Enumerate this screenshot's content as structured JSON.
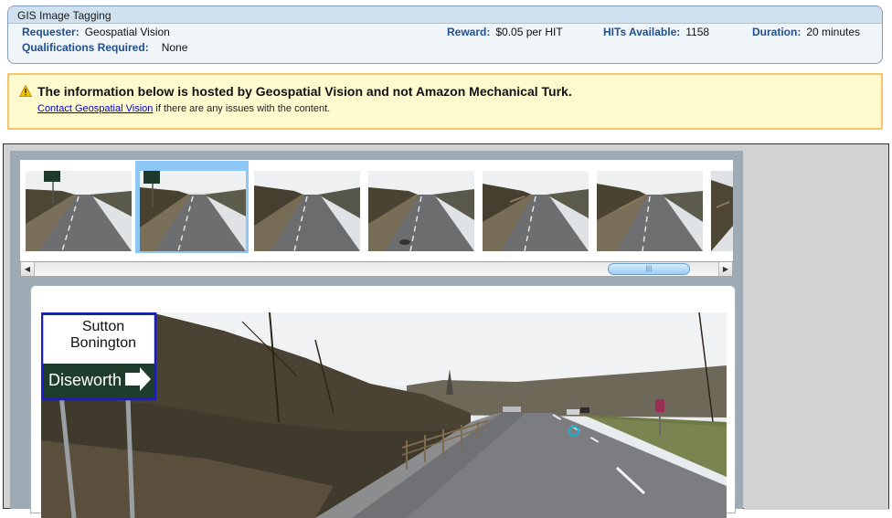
{
  "hit": {
    "title": "GIS Image Tagging",
    "requester_label": "Requester:",
    "requester": "Geospatial Vision",
    "qualifications_label": "Qualifications Required:",
    "qualifications": "None",
    "reward_label": "Reward:",
    "reward": "$0.05 per HIT",
    "hits_label": "HITs Available:",
    "hits": "1158",
    "duration_label": "Duration:",
    "duration": "20 minutes"
  },
  "notice": {
    "title": "The information below is hosted by Geospatial Vision and not Amazon Mechanical Turk.",
    "link": "Contact Geospatial Vision",
    "rest": " if there are any issues with the content."
  },
  "sign": {
    "line1": "Sutton",
    "line2": "Bonington",
    "line3": "Diseworth"
  },
  "colors": {
    "selection": "#8cc7f5",
    "sign_box": "#1a1acc",
    "target_marker": "#14b4d4"
  },
  "thumbnails": {
    "count": 7,
    "selected_index": 1
  }
}
